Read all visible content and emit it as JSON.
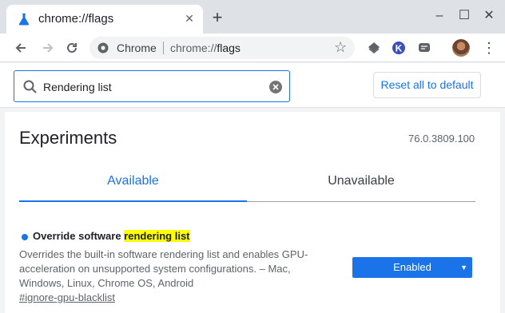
{
  "browser": {
    "tab_title": "chrome://flags",
    "new_tab": "+",
    "window_controls": {
      "minimize": "–",
      "maximize": "☐",
      "close": "✕"
    },
    "omnibox": {
      "chip": "Chrome",
      "url_scheme": "chrome://",
      "url_host": "flags"
    },
    "icons": [
      "back-icon",
      "forward-icon",
      "reload-icon",
      "star-icon",
      "extension-icon",
      "k-extension-icon",
      "chat-extension-icon",
      "menu-icon"
    ]
  },
  "flags_header": {
    "search_value": "Rendering list",
    "reset_label": "Reset all to default"
  },
  "main": {
    "title": "Experiments",
    "version": "76.0.3809.100",
    "tabs": [
      {
        "label": "Available",
        "active": true
      },
      {
        "label": "Unavailable",
        "active": false
      }
    ]
  },
  "experiment": {
    "name_prefix": "Override software ",
    "name_highlight": "rendering list",
    "description": "Overrides the built-in software rendering list and enables GPU-acceleration on unsupported system configurations. – Mac, Windows, Linux, Chrome OS, Android",
    "link": "#ignore-gpu-blacklist",
    "select_value": "Enabled"
  },
  "colors": {
    "accent": "#1a73e8",
    "highlight": "#ffff00"
  }
}
